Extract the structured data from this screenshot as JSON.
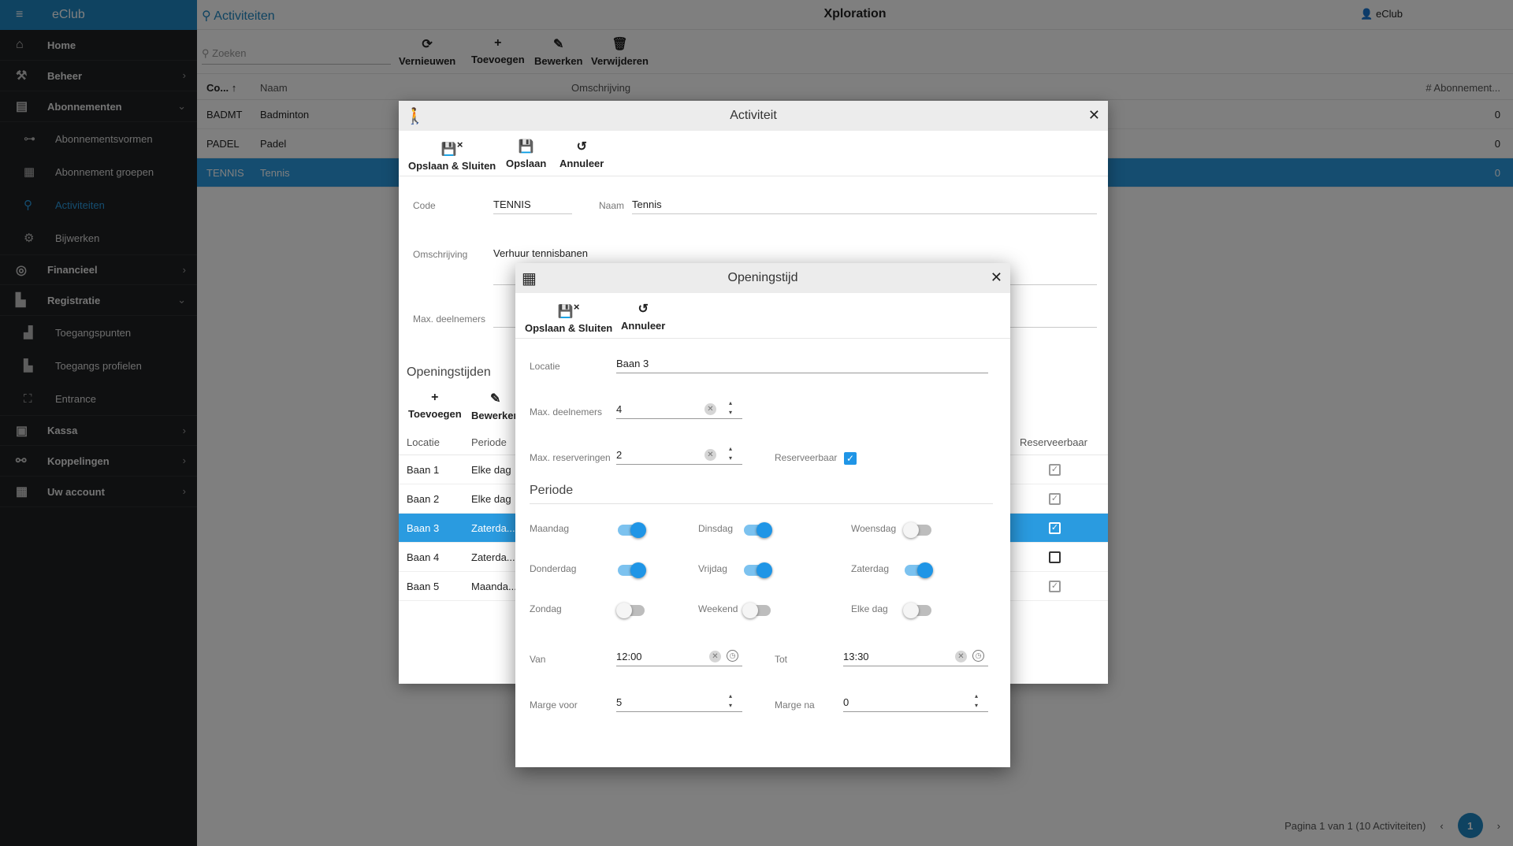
{
  "sidebar": {
    "brand": "eClub",
    "items": [
      {
        "label": "Home",
        "icon": "home-icon"
      },
      {
        "label": "Beheer",
        "icon": "wrench-icon"
      },
      {
        "label": "Abonnementen",
        "icon": "document-icon"
      },
      {
        "label": "Abonnementsvormen",
        "icon": "flow-icon"
      },
      {
        "label": "Abonnement groepen",
        "icon": "file-icon"
      },
      {
        "label": "Activiteiten",
        "icon": "hiker-icon"
      },
      {
        "label": "Bijwerken",
        "icon": "gears-icon"
      },
      {
        "label": "Financieel",
        "icon": "coins-icon"
      },
      {
        "label": "Registratie",
        "icon": "building-icon"
      },
      {
        "label": "Toegangspunten",
        "icon": "door-icon"
      },
      {
        "label": "Toegangs profielen",
        "icon": "building-icon"
      },
      {
        "label": "Entrance",
        "icon": "face-scan-icon"
      },
      {
        "label": "Kassa",
        "icon": "register-icon"
      },
      {
        "label": "Koppelingen",
        "icon": "link-icon"
      },
      {
        "label": "Uw account",
        "icon": "building-icon"
      }
    ]
  },
  "header": {
    "page_title": "Activiteiten",
    "app_title": "Xploration",
    "user": "eClub"
  },
  "toolbar": {
    "search_placeholder": "Zoeken",
    "refresh": "Vernieuwen",
    "add": "Toevoegen",
    "edit": "Bewerken",
    "delete": "Verwijderen"
  },
  "grid": {
    "columns": [
      "Co...",
      "Naam",
      "Omschrijving",
      "# Abonnement..."
    ],
    "rows": [
      {
        "code": "BADMT",
        "naam": "Badminton",
        "count": "0"
      },
      {
        "code": "PADEL",
        "naam": "Padel",
        "count": "0"
      },
      {
        "code": "TENNIS",
        "naam": "Tennis",
        "count": "0"
      }
    ],
    "pager": "Pagina 1 van 1 (10 Activiteiten)",
    "page": "1"
  },
  "dialog1": {
    "title": "Activiteit",
    "save_close": "Opslaan & Sluiten",
    "save": "Opslaan",
    "cancel": "Annuleer",
    "code_label": "Code",
    "code_value": "TENNIS",
    "naam_label": "Naam",
    "naam_value": "Tennis",
    "omschrijving_label": "Omschrijving",
    "omschrijving_value": "Verhuur tennisbanen",
    "max_label": "Max. deelnemers",
    "section": "Openingstijden",
    "add": "Toevoegen",
    "edit": "Bewerken",
    "columns": [
      "Locatie",
      "Periode",
      "Reserveerbaar"
    ],
    "rows": [
      {
        "locatie": "Baan 1",
        "periode": "Elke dag"
      },
      {
        "locatie": "Baan 2",
        "periode": "Elke dag"
      },
      {
        "locatie": "Baan 3",
        "periode": "Zaterda..."
      },
      {
        "locatie": "Baan 4",
        "periode": "Zaterda..."
      },
      {
        "locatie": "Baan 5",
        "periode": "Maanda..."
      }
    ]
  },
  "dialog2": {
    "title": "Openingstijd",
    "save_close": "Opslaan & Sluiten",
    "cancel": "Annuleer",
    "locatie_label": "Locatie",
    "locatie_value": "Baan 3",
    "max_deelnemers_label": "Max. deelnemers",
    "max_deelnemers_value": "4",
    "max_reserveringen_label": "Max. reserveringen",
    "max_reserveringen_value": "2",
    "reserveerbaar_label": "Reserveerbaar",
    "periode_title": "Periode",
    "days": [
      {
        "label": "Maandag",
        "on": true
      },
      {
        "label": "Dinsdag",
        "on": true
      },
      {
        "label": "Woensdag",
        "on": false
      },
      {
        "label": "Donderdag",
        "on": true
      },
      {
        "label": "Vrijdag",
        "on": true
      },
      {
        "label": "Zaterdag",
        "on": true
      },
      {
        "label": "Zondag",
        "on": false
      },
      {
        "label": "Weekend",
        "on": false
      },
      {
        "label": "Elke dag",
        "on": false
      }
    ],
    "van_label": "Van",
    "van_value": "12:00",
    "tot_label": "Tot",
    "tot_value": "13:30",
    "marge_voor_label": "Marge voor",
    "marge_voor_value": "5",
    "marge_na_label": "Marge na",
    "marge_na_value": "0"
  },
  "colors": {
    "accent": "#1f87c3",
    "selection": "#2a9be0",
    "sidebar_bg": "#1e2022"
  }
}
